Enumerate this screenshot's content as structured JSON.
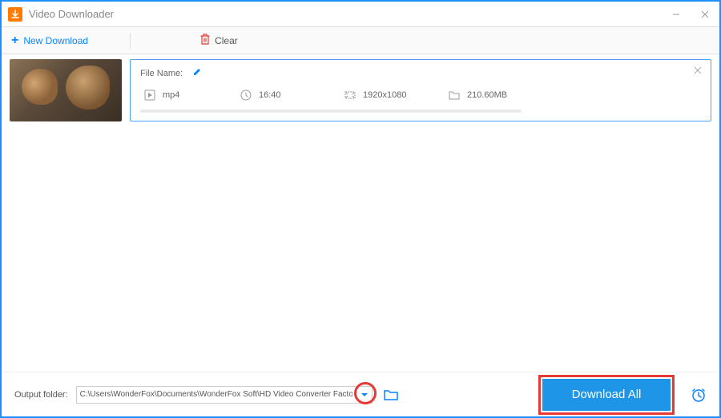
{
  "titlebar": {
    "app_name": "Video Downloader"
  },
  "toolbar": {
    "new_download_label": "New Download",
    "clear_label": "Clear"
  },
  "item": {
    "file_name_label": "File Name:",
    "format": "mp4",
    "duration": "16:40",
    "resolution": "1920x1080",
    "size": "210.60MB"
  },
  "bottom": {
    "output_folder_label": "Output folder:",
    "output_path": "C:\\Users\\WonderFox\\Documents\\WonderFox Soft\\HD Video Converter Factory\\Download_Video\\",
    "download_all_label": "Download All"
  }
}
